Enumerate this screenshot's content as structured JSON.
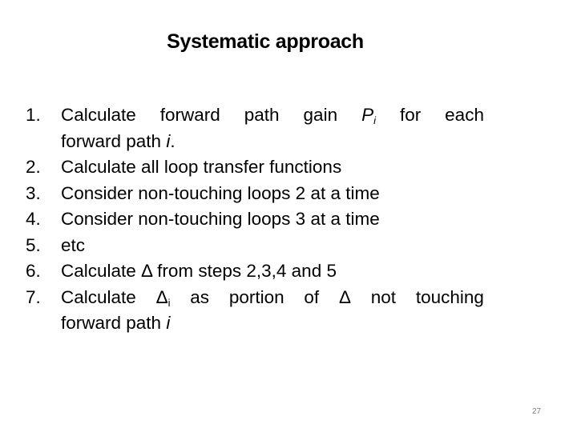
{
  "slide": {
    "title": "Systematic approach",
    "page_number": "27",
    "items": [
      {
        "num": "1.",
        "words": [
          "Calculate",
          "forward",
          "path",
          "gain"
        ],
        "var": "P",
        "sub": "i",
        "words_after": [
          "for",
          "each"
        ],
        "line2": "forward path ",
        "line2_var": "i",
        "line2_end": "."
      },
      {
        "num": "2.",
        "text": "Calculate all loop transfer functions"
      },
      {
        "num": "3.",
        "text": "Consider non-touching loops 2 at a time"
      },
      {
        "num": "4.",
        "text": "Consider non-touching loops 3 at a time"
      },
      {
        "num": "5.",
        "text": "etc"
      },
      {
        "num": "6.",
        "text": "Calculate Δ from steps 2,3,4 and 5"
      },
      {
        "num": "7.",
        "words": [
          "Calculate"
        ],
        "delta": "Δ",
        "sub": "i",
        "words_after": [
          "as",
          "portion",
          "of",
          "Δ",
          "not",
          "touching"
        ],
        "line2": "forward path ",
        "line2_var": "i",
        "line2_end": ""
      }
    ]
  }
}
